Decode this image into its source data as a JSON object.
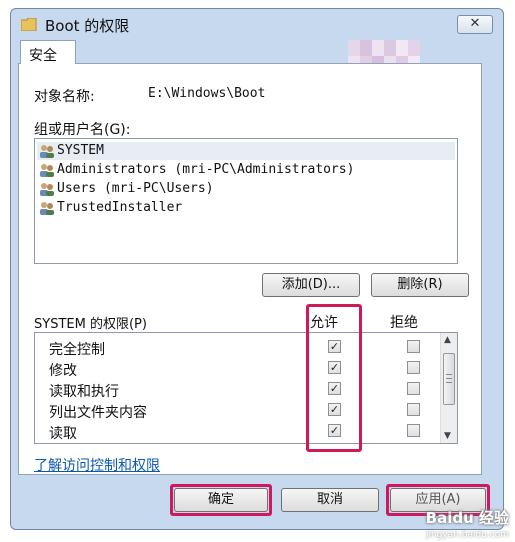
{
  "window": {
    "title": "Boot 的权限",
    "close_glyph": "✕"
  },
  "tab": {
    "label": "安全"
  },
  "object": {
    "label": "对象名称:",
    "value": "E:\\Windows\\Boot"
  },
  "groups": {
    "label": "组或用户名(G):",
    "items": [
      {
        "label": "SYSTEM",
        "selected": true
      },
      {
        "label": "Administrators (mri-PC\\Administrators)",
        "selected": false
      },
      {
        "label": "Users (mri-PC\\Users)",
        "selected": false
      },
      {
        "label": "TrustedInstaller",
        "selected": false
      }
    ]
  },
  "group_buttons": {
    "add": "添加(D)...",
    "remove": "删除(R)"
  },
  "permissions": {
    "label": "SYSTEM 的权限(P)",
    "allow_header": "允许",
    "deny_header": "拒绝",
    "rows": [
      {
        "name": "完全控制",
        "allow": true,
        "deny": false
      },
      {
        "name": "修改",
        "allow": true,
        "deny": false
      },
      {
        "name": "读取和执行",
        "allow": true,
        "deny": false
      },
      {
        "name": "列出文件夹内容",
        "allow": true,
        "deny": false
      },
      {
        "name": "读取",
        "allow": true,
        "deny": false
      }
    ]
  },
  "link": "了解访问控制和权限",
  "footer": {
    "ok": "确定",
    "cancel": "取消",
    "apply": "应用(A)"
  },
  "watermark": {
    "brand": "Baidu 经验",
    "url": "jingyan.baidu.com"
  },
  "colors": {
    "highlight": "#d1185a",
    "frame": "#c7d9ee",
    "link": "#0b57b3"
  }
}
